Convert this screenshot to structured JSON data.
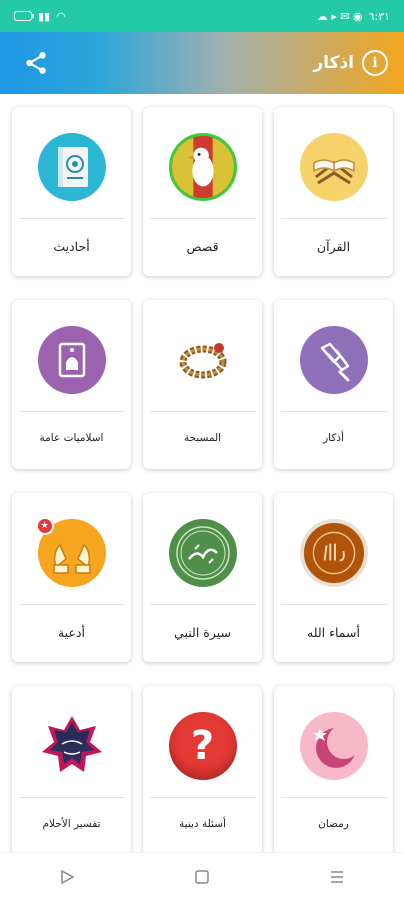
{
  "status_bar": {
    "time": "٦:٣١",
    "colors": {
      "background": "#24c9a8"
    }
  },
  "header": {
    "title": "اذكار",
    "info_icon": "info-icon",
    "share_icon": "share-icon"
  },
  "grid": {
    "items": [
      {
        "label": "القرآن",
        "icon": "quran-book-icon"
      },
      {
        "label": "قصص",
        "icon": "bird-icon"
      },
      {
        "label": "أحاديث",
        "icon": "hadith-book-icon"
      },
      {
        "label": "أذكار",
        "icon": "hands-icon"
      },
      {
        "label": "المسبحة",
        "icon": "prayer-beads-icon"
      },
      {
        "label": "اسلاميات عامة",
        "icon": "mosque-card-icon"
      },
      {
        "label": "أسماء الله",
        "icon": "allah-calligraphy-icon"
      },
      {
        "label": "سيرة النبي",
        "icon": "muhammad-calligraphy-icon"
      },
      {
        "label": "أدعية",
        "icon": "praying-hands-icon"
      },
      {
        "label": "رمضان",
        "icon": "crescent-star-icon"
      },
      {
        "label": "أسئلة دينية",
        "icon": "question-mark-icon"
      },
      {
        "label": "تفسير الأحلام",
        "icon": "dream-star-icon"
      }
    ]
  },
  "nav_bar": {
    "back_icon": "back-triangle-icon",
    "home_icon": "home-square-icon",
    "recents_icon": "recents-lines-icon"
  }
}
